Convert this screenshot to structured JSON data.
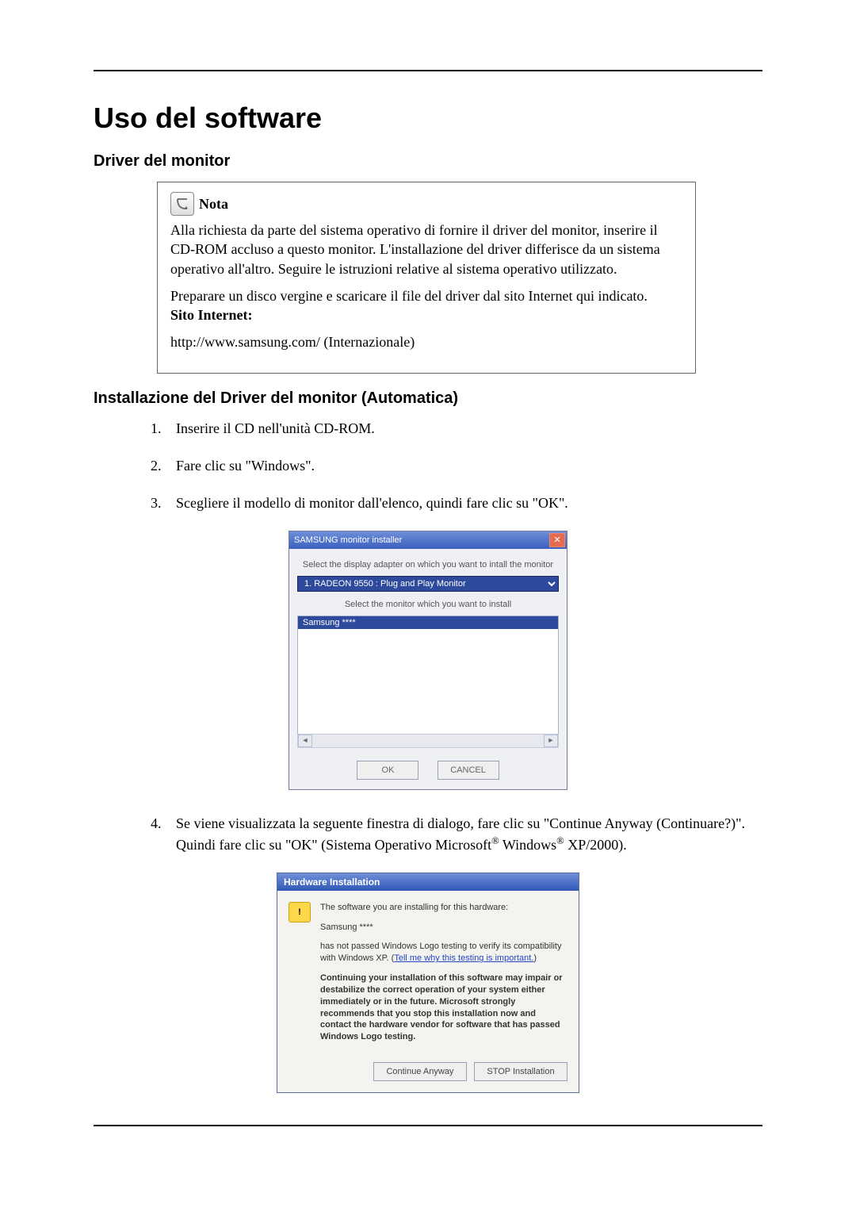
{
  "title": "Uso del software",
  "section1": "Driver del monitor",
  "note": {
    "label": "Nota",
    "p1": "Alla richiesta da parte del sistema operativo di fornire il driver del monitor, inserire il CD-ROM accluso a questo monitor. L'installazione del driver differisce da un sistema operativo all'altro. Seguire le istruzioni relative al sistema operativo utilizzato.",
    "p2": "Preparare un disco vergine e scaricare il file del driver dal sito Internet qui indicato.",
    "sitelabel": "Sito Internet:",
    "url": "http://www.samsung.com/ (Internazionale)"
  },
  "section2": "Installazione del Driver del monitor (Automatica)",
  "steps": {
    "s1": "Inserire il CD nell'unità CD-ROM.",
    "s2": "Fare clic su \"Windows\".",
    "s3": "Scegliere il modello di monitor dall'elenco, quindi fare clic su \"OK\".",
    "s4a": "Se viene visualizzata la seguente finestra di dialogo, fare clic su \"Continue Anyway (Continuare?)\". Quindi fare clic su \"OK\" (Sistema Operativo Microsoft",
    "s4b": " Windows",
    "s4c": " XP/2000)."
  },
  "installer": {
    "title": "SAMSUNG monitor installer",
    "caption1": "Select the display adapter on which you want to intall the monitor",
    "adapter": "1. RADEON 9550 : Plug and Play Monitor",
    "caption2": "Select the monitor which you want to install",
    "listsel": "Samsung ****",
    "ok": "OK",
    "cancel": "CANCEL"
  },
  "hwi": {
    "title": "Hardware Installation",
    "line1": "The software you are installing for this hardware:",
    "device": "Samsung ****",
    "line2a": "has not passed Windows Logo testing to verify its compatibility with Windows XP. (",
    "link": "Tell me why this testing is important.",
    "line2b": ")",
    "strong": "Continuing your installation of this software may impair or destabilize the correct operation of your system either immediately or in the future. Microsoft strongly recommends that you stop this installation now and contact the hardware vendor for software that has passed Windows Logo testing.",
    "btn_continue": "Continue Anyway",
    "btn_stop": "STOP Installation"
  }
}
